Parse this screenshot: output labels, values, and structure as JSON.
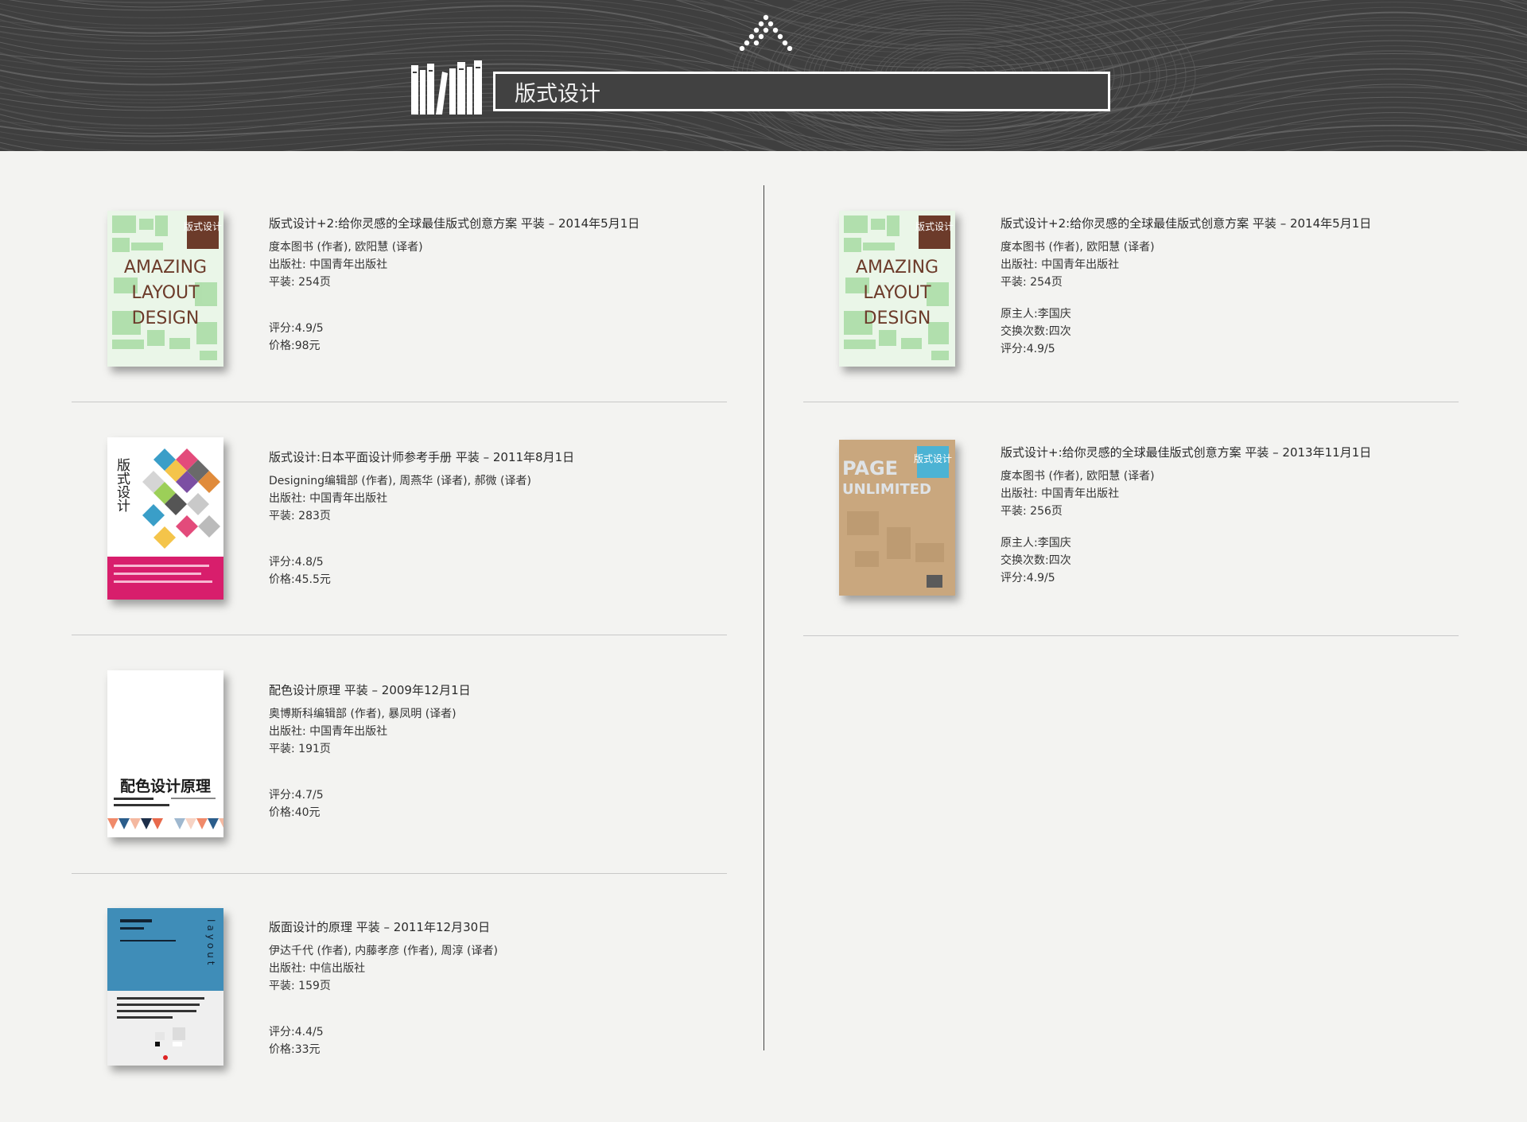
{
  "search": {
    "value": "版式设计"
  },
  "left_books": [
    {
      "title": "版式设计+2:给你灵感的全球最佳版式创意方案 平装 – 2014年5月1日",
      "authors": "度本图书 (作者), 欧阳慧 (译者)",
      "publisher": "出版社: 中国青年出版社",
      "pages": "平装: 254页",
      "rating": "评分:4.9/5",
      "price": "价格:98元",
      "cover": {
        "type": "amazing",
        "side_text": "版式设计",
        "main_text": [
          "AMAZING",
          "LAYOUT",
          "DESIGN"
        ]
      }
    },
    {
      "title": "版式设计:日本平面设计师参考手册 平装 – 2011年8月1日",
      "authors": "Designing编辑部 (作者), 周燕华 (译者), 郝微 (译者)",
      "publisher": "出版社: 中国青年出版社",
      "pages": "平装: 283页",
      "rating": "评分:4.8/5",
      "price": "价格:45.5元",
      "cover": {
        "type": "japan",
        "side_text": "版式设计"
      }
    },
    {
      "title": "配色设计原理 平装 – 2009年12月1日",
      "authors": "奥博斯科编辑部 (作者), 暴凤明 (译者)",
      "publisher": "出版社: 中国青年出版社",
      "pages": "平装: 191页",
      "rating": "评分:4.7/5",
      "price": "价格:40元",
      "cover": {
        "type": "color",
        "main_text": "配色设计原理"
      }
    },
    {
      "title": "版面设计的原理 平装 – 2011年12月30日",
      "authors": "伊达千代 (作者), 内藤孝彦 (作者), 周淳 (译者)",
      "publisher": "出版社: 中信出版社",
      "pages": "平装: 159页",
      "rating": "评分:4.4/5",
      "price": "价格:33元",
      "cover": {
        "type": "layout",
        "side_text": "layout"
      }
    }
  ],
  "right_books": [
    {
      "title": "版式设计+2:给你灵感的全球最佳版式创意方案 平装 – 2014年5月1日",
      "authors": "度本图书 (作者), 欧阳慧 (译者)",
      "publisher": "出版社: 中国青年出版社",
      "pages": "平装: 254页",
      "owner": "原主人:李国庆",
      "exchanges": "交换次数:四次",
      "rating": "评分:4.9/5",
      "cover": {
        "type": "amazing",
        "side_text": "版式设计",
        "main_text": [
          "AMAZING",
          "LAYOUT",
          "DESIGN"
        ]
      }
    },
    {
      "title": "版式设计+:给你灵感的全球最佳版式创意方案 平装 – 2013年11月1日",
      "authors": "度本图书 (作者), 欧阳慧 (译者)",
      "publisher": "出版社: 中国青年出版社",
      "pages": "平装: 256页",
      "owner": "原主人:李国庆",
      "exchanges": "交换次数:四次",
      "rating": "评分:4.9/5",
      "cover": {
        "type": "page",
        "side_text": "版式设计",
        "main_text": [
          "PAGE",
          "UNLIMITED"
        ]
      }
    }
  ]
}
